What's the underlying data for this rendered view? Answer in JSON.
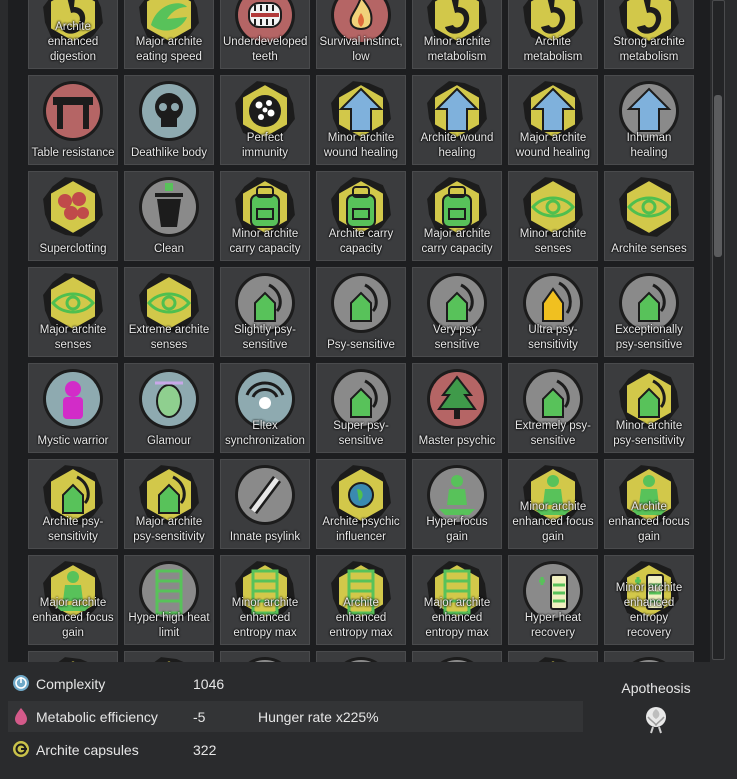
{
  "colors": {
    "hex_yellow": "#d2c84a",
    "hex_gray": "#8a8a8a",
    "circle_blue": "#8eaab0",
    "circle_red": "#b56565",
    "glyph_dark": "#1c1c1c",
    "green": "#58c25a",
    "blue": "#7fb1dc",
    "magenta": "#d22cc8"
  },
  "genes": [
    {
      "label": "Archite enhanced digestion",
      "shape": "hex",
      "bg": "yellow",
      "glyph": "stomach"
    },
    {
      "label": "Major archite eating speed",
      "shape": "hex",
      "bg": "yellow",
      "glyph": "mouth-green"
    },
    {
      "label": "Underdeveloped teeth",
      "shape": "circle",
      "bg": "red",
      "glyph": "teeth"
    },
    {
      "label": "Survival instinct, low",
      "shape": "circle",
      "bg": "red",
      "glyph": "flame"
    },
    {
      "label": "Minor archite metabolism",
      "shape": "hex",
      "bg": "yellow",
      "glyph": "stomach"
    },
    {
      "label": "Archite metabolism",
      "shape": "hex",
      "bg": "yellow",
      "glyph": "stomach"
    },
    {
      "label": "Strong archite metabolism",
      "shape": "hex",
      "bg": "yellow",
      "glyph": "stomach"
    },
    {
      "label": "Table resistance",
      "shape": "circle",
      "bg": "red",
      "glyph": "table"
    },
    {
      "label": "Deathlike body",
      "shape": "circle",
      "bg": "blue",
      "glyph": "skull"
    },
    {
      "label": "Perfect immunity",
      "shape": "hex",
      "bg": "yellow",
      "glyph": "dots"
    },
    {
      "label": "Minor archite wound healing",
      "shape": "hex",
      "bg": "yellow",
      "glyph": "arrow-up"
    },
    {
      "label": "Archite wound healing",
      "shape": "hex",
      "bg": "yellow",
      "glyph": "arrow-up"
    },
    {
      "label": "Major archite wound healing",
      "shape": "hex",
      "bg": "yellow",
      "glyph": "arrow-up"
    },
    {
      "label": "Inhuman healing",
      "shape": "circle",
      "bg": "gray",
      "glyph": "arrow-up"
    },
    {
      "label": "Superclotting",
      "shape": "hex",
      "bg": "yellow",
      "glyph": "cells"
    },
    {
      "label": "Clean",
      "shape": "circle",
      "bg": "gray",
      "glyph": "trash"
    },
    {
      "label": "Minor archite carry capacity",
      "shape": "hex",
      "bg": "yellow",
      "glyph": "backpack"
    },
    {
      "label": "Archite carry capacity",
      "shape": "hex",
      "bg": "yellow",
      "glyph": "backpack"
    },
    {
      "label": "Major archite carry capacity",
      "shape": "hex",
      "bg": "yellow",
      "glyph": "backpack"
    },
    {
      "label": "Minor archite senses",
      "shape": "hex",
      "bg": "yellow",
      "glyph": "eye"
    },
    {
      "label": "Archite senses",
      "shape": "hex",
      "bg": "yellow",
      "glyph": "eye"
    },
    {
      "label": "Major archite senses",
      "shape": "hex",
      "bg": "yellow",
      "glyph": "eye"
    },
    {
      "label": "Extreme archite senses",
      "shape": "hex",
      "bg": "yellow",
      "glyph": "eye"
    },
    {
      "label": "Slightly psy-sensitive",
      "shape": "circle",
      "bg": "gray",
      "glyph": "psy"
    },
    {
      "label": "Psy-sensitive",
      "shape": "circle",
      "bg": "gray",
      "glyph": "psy"
    },
    {
      "label": "Very psy-sensitive",
      "shape": "circle",
      "bg": "gray",
      "glyph": "psy"
    },
    {
      "label": "Ultra psy-sensitivity",
      "shape": "circle",
      "bg": "gray",
      "glyph": "psy-yellow"
    },
    {
      "label": "Exceptionally psy-sensitive",
      "shape": "circle",
      "bg": "gray",
      "glyph": "psy"
    },
    {
      "label": "Mystic warrior",
      "shape": "circle",
      "bg": "blue",
      "glyph": "warrior"
    },
    {
      "label": "Glamour",
      "shape": "circle",
      "bg": "blue",
      "glyph": "face"
    },
    {
      "label": "Eltex synchronization",
      "shape": "circle",
      "bg": "blue",
      "glyph": "waves"
    },
    {
      "label": "Super psy-sensitive",
      "shape": "circle",
      "bg": "gray",
      "glyph": "psy"
    },
    {
      "label": "Master psychic",
      "shape": "circle",
      "bg": "red",
      "glyph": "tree"
    },
    {
      "label": "Extremely psy-sensitive",
      "shape": "circle",
      "bg": "gray",
      "glyph": "psy"
    },
    {
      "label": "Minor archite psy-sensitivity",
      "shape": "hex",
      "bg": "yellow",
      "glyph": "psy"
    },
    {
      "label": "Archite psy-sensitivity",
      "shape": "hex",
      "bg": "yellow",
      "glyph": "psy"
    },
    {
      "label": "Major archite psy-sensitivity",
      "shape": "hex",
      "bg": "yellow",
      "glyph": "psy"
    },
    {
      "label": "Innate psylink",
      "shape": "circle",
      "bg": "gray",
      "glyph": "link"
    },
    {
      "label": "Archite psychic influencer",
      "shape": "hex",
      "bg": "yellow",
      "glyph": "globe"
    },
    {
      "label": "Hyper focus gain",
      "shape": "circle",
      "bg": "gray",
      "glyph": "meditate"
    },
    {
      "label": "Minor archite enhanced focus gain",
      "shape": "hex",
      "bg": "yellow",
      "glyph": "meditate"
    },
    {
      "label": "Archite enhanced focus gain",
      "shape": "hex",
      "bg": "yellow",
      "glyph": "meditate"
    },
    {
      "label": "Major archite enhanced focus gain",
      "shape": "hex",
      "bg": "yellow",
      "glyph": "meditate"
    },
    {
      "label": "Hyper high heat limit",
      "shape": "circle",
      "bg": "gray",
      "glyph": "ladder"
    },
    {
      "label": "Minor archite enhanced entropy max",
      "shape": "hex",
      "bg": "yellow",
      "glyph": "ladder"
    },
    {
      "label": "Archite enhanced entropy max",
      "shape": "hex",
      "bg": "yellow",
      "glyph": "ladder"
    },
    {
      "label": "Major archite enhanced entropy max",
      "shape": "hex",
      "bg": "yellow",
      "glyph": "ladder"
    },
    {
      "label": "Hyper heat recovery",
      "shape": "circle",
      "bg": "gray",
      "glyph": "battery"
    },
    {
      "label": "Minor archite enhanced entropy recovery",
      "shape": "hex",
      "bg": "yellow",
      "glyph": "battery"
    },
    {
      "label": "",
      "shape": "hex",
      "bg": "yellow",
      "glyph": "none"
    },
    {
      "label": "",
      "shape": "hex",
      "bg": "yellow",
      "glyph": "none"
    },
    {
      "label": "",
      "shape": "circle",
      "bg": "gray",
      "glyph": "none"
    },
    {
      "label": "",
      "shape": "circle",
      "bg": "gray",
      "glyph": "none"
    },
    {
      "label": "",
      "shape": "circle",
      "bg": "gray",
      "glyph": "none"
    },
    {
      "label": "",
      "shape": "hex",
      "bg": "yellow",
      "glyph": "none"
    },
    {
      "label": "",
      "shape": "circle",
      "bg": "gray",
      "glyph": "none"
    }
  ],
  "stats": {
    "complexity": {
      "label": "Complexity",
      "value": "1046"
    },
    "metabolic": {
      "label": "Metabolic efficiency",
      "value": "-5",
      "note": "Hunger rate x225%"
    },
    "archite": {
      "label": "Archite capsules",
      "value": "322"
    }
  },
  "apotheosis": {
    "label": "Apotheosis"
  }
}
